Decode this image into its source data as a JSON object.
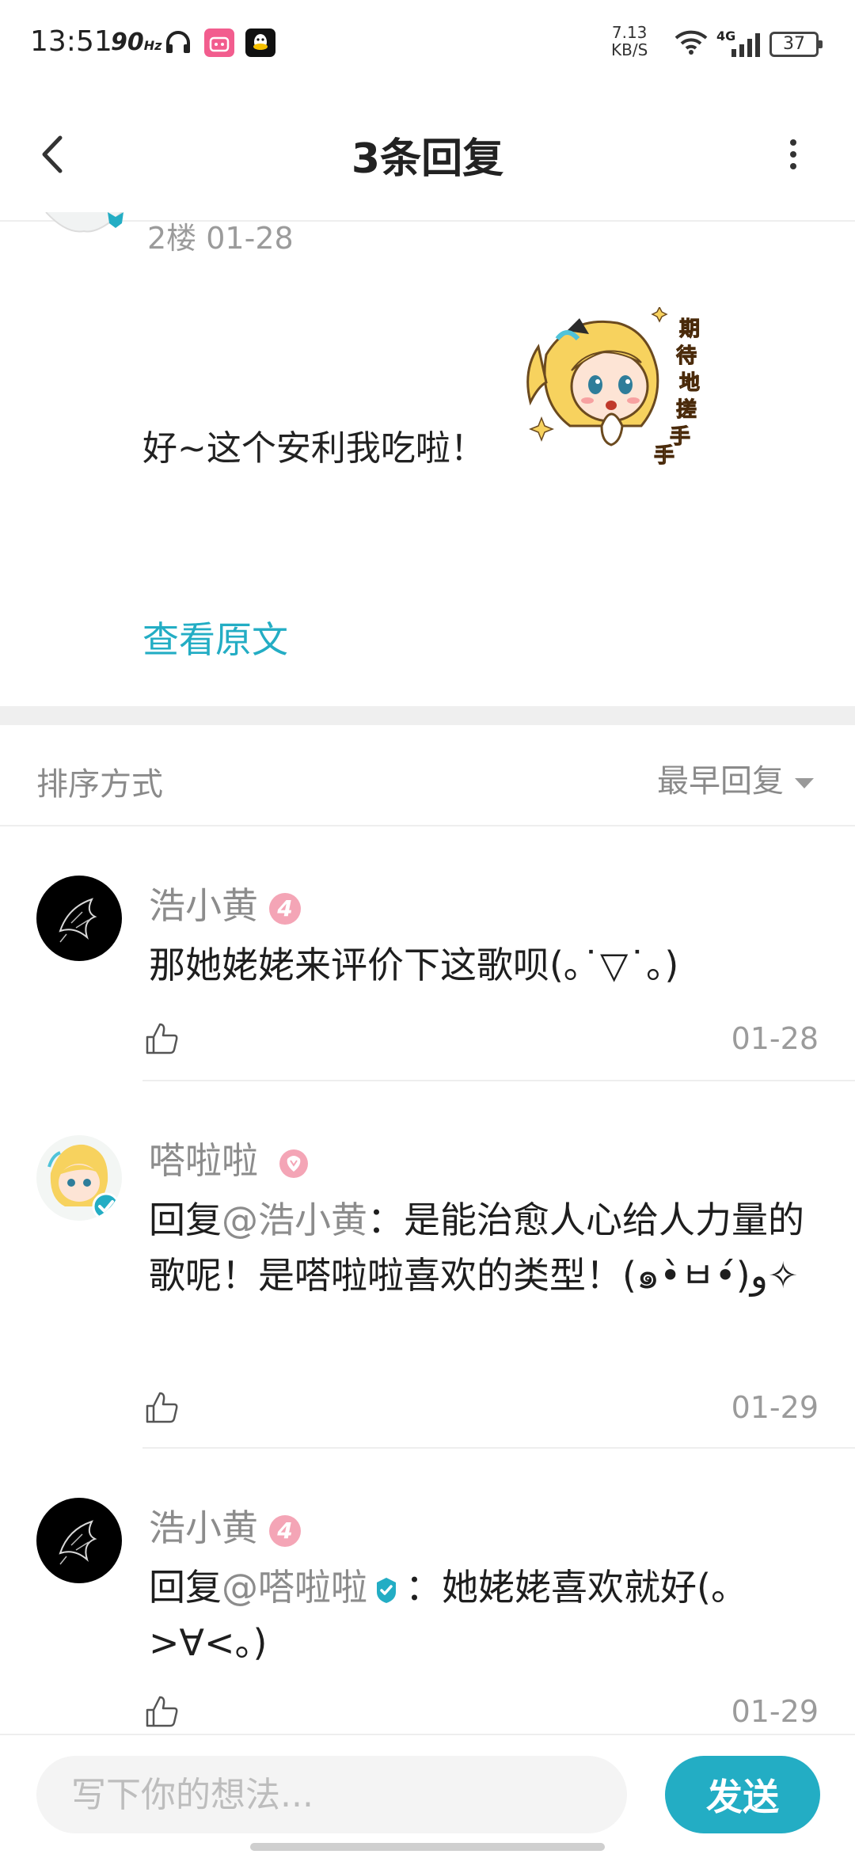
{
  "status_bar": {
    "time": "13:51",
    "refresh_rate": "90",
    "refresh_unit": "Hz",
    "net_speed_value": "7.13",
    "net_speed_unit": "KB/S",
    "network_type": "4G",
    "battery": "37"
  },
  "header": {
    "title": "3条回复"
  },
  "original_post": {
    "floor_and_date": "2楼   01-28",
    "text": "好~这个安利我吃啦！",
    "sticker_text": "期待地搓手手",
    "view_original_label": "查看原文"
  },
  "sort": {
    "label": "排序方式",
    "selected": "最早回复"
  },
  "replies": [
    {
      "user": "浩小黄",
      "level": "4",
      "text": "那她姥姥来评价下这歌呗(｡˙▽˙｡)",
      "date": "01-28"
    },
    {
      "user": "嗒啦啦",
      "reply_prefix": "回复",
      "mention": "@浩小黄",
      "text": "：是能治愈人心给人力量的歌呢！是嗒啦啦喜欢的类型！(๑•̀ㅂ•́)و✧",
      "date": "01-29"
    },
    {
      "user": "浩小黄",
      "level": "4",
      "reply_prefix": "回复",
      "mention": "@嗒啦啦",
      "text": "：她姥姥喜欢就好(。>∀<。)",
      "date": "01-29"
    }
  ],
  "composer": {
    "placeholder": "写下你的想法...",
    "send_label": "发送"
  },
  "colors": {
    "accent": "#23adc4",
    "level_badge": "#f4a5b6",
    "muted_text": "#8c8c8c"
  }
}
